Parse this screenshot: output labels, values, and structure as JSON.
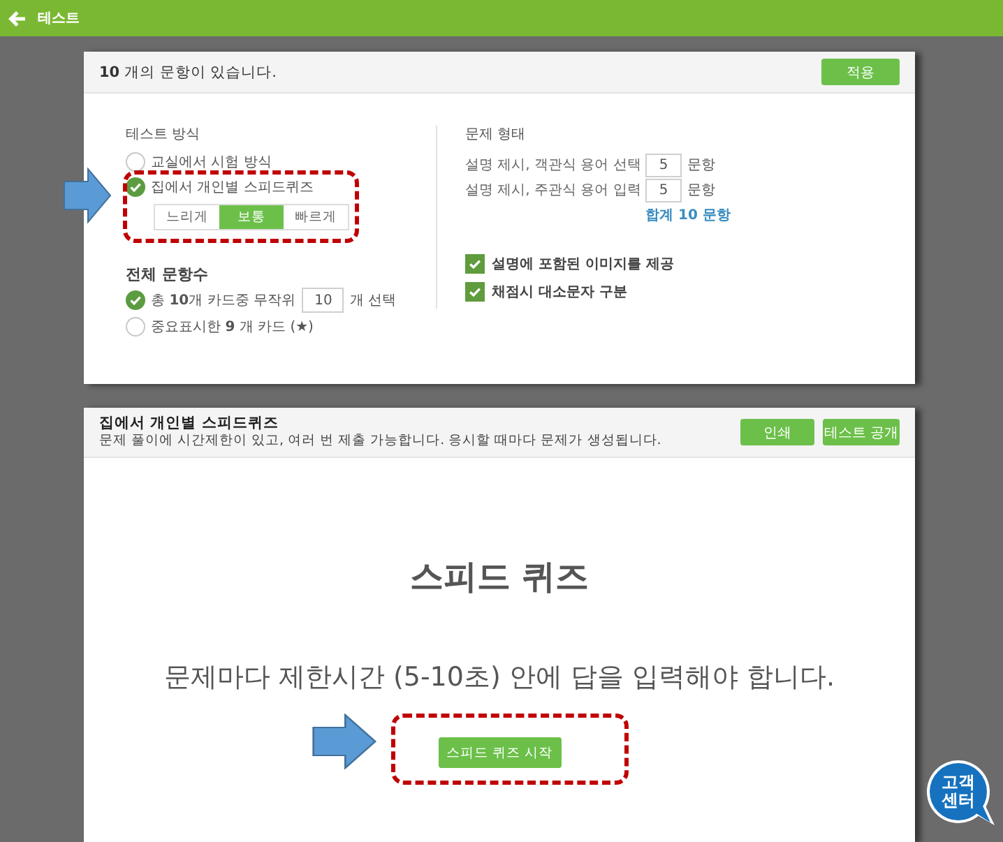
{
  "top_bar": {
    "title": "테스트"
  },
  "settings_card": {
    "header": {
      "count_text": "**10** 개의 문항이 있습니다.",
      "apply_button": "적용"
    },
    "test_method": {
      "heading": "테스트 방식",
      "options": [
        {
          "label": "교실에서 시험 방식",
          "selected": false
        },
        {
          "label": "집에서 개인별 스피드퀴즈",
          "selected": true,
          "speeds": [
            {
              "label": "느리게",
              "selected": false
            },
            {
              "label": "보통",
              "selected": true
            },
            {
              "label": "빠르게",
              "selected": false
            }
          ]
        }
      ]
    },
    "question_count": {
      "heading": "전체 문항수",
      "options": [
        {
          "kind": "random",
          "label": "총 **10**개 카드중 무작위",
          "value": "10",
          "suffix": "개 선택",
          "selected": true
        },
        {
          "kind": "starred",
          "label": "중요표시한 **9** 개 카드 (★)",
          "selected": false
        }
      ]
    },
    "question_type": {
      "heading": "문제 형태",
      "rows": [
        {
          "label": "설명 제시, 객관식 용어 선택",
          "value": "5",
          "unit": "문항"
        },
        {
          "label": "설명 제시, 주관식 용어 입력",
          "value": "5",
          "unit": "문항"
        }
      ],
      "total": "합계 10 문항"
    },
    "options": [
      {
        "label": "설명에 포함된 이미지를 제공",
        "checked": true
      },
      {
        "label": "채점시 대소문자 구분",
        "checked": true
      }
    ]
  },
  "quiz_card": {
    "title": "집에서 개인별 스피드퀴즈",
    "description": "문제 풀이에 시간제한이 있고, 여러 번 제출 가능합니다. 응시할 때마다 문제가 생성됩니다.",
    "buttons": [
      "인쇄",
      "테스트 공개"
    ],
    "heading": "스피드 퀴즈",
    "instruction": "문제마다 제한시간 (5-10초) 안에 답을 입력해야 합니다.",
    "start_button": "스피드 퀴즈 시작"
  },
  "help_badge": {
    "label": "고객 센터"
  }
}
